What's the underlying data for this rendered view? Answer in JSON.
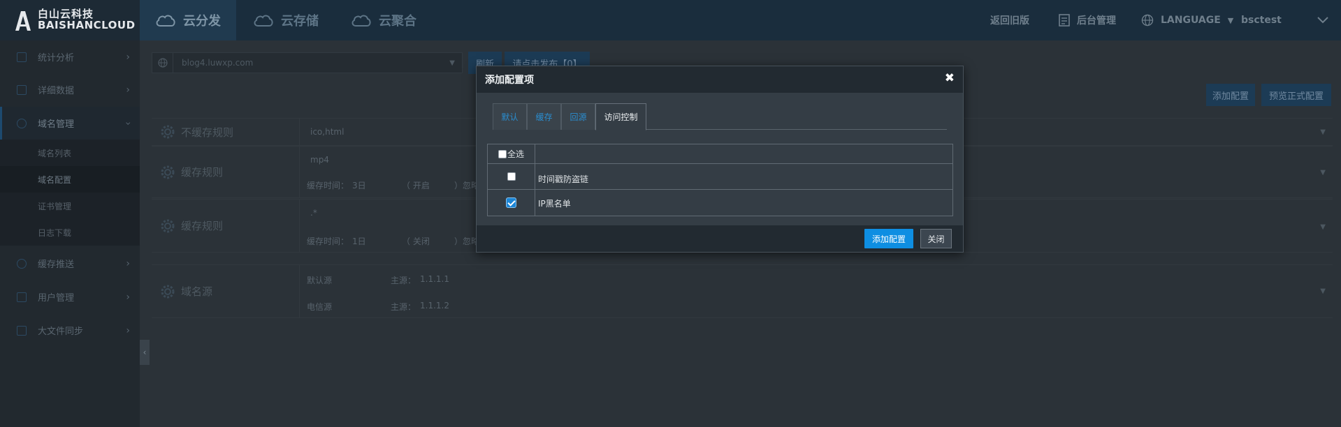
{
  "brand": {
    "name_cn": "白山云科技",
    "name_en": "BAISHANCLOUD"
  },
  "nav": {
    "tabs": [
      "云分发",
      "云存储",
      "云聚合"
    ]
  },
  "header": {
    "old_version": "返回旧版",
    "admin": "后台管理",
    "language": "LANGUAGE",
    "user": "bsctest"
  },
  "sidebar": {
    "items": [
      {
        "label": "统计分析"
      },
      {
        "label": "详细数据"
      },
      {
        "label": "域名管理"
      },
      {
        "label": "缓存推送"
      },
      {
        "label": "用户管理"
      },
      {
        "label": "大文件同步"
      }
    ],
    "subitems": [
      "域名列表",
      "域名配置",
      "证书管理",
      "日志下载"
    ],
    "collapse_icon": "‹"
  },
  "main": {
    "domain_select": "blog4.luwxp.com",
    "refresh_button": "刷新",
    "publish_button": "请点击发布【0】",
    "add_config_button": "添加配置",
    "preview_button": "预览正式配置",
    "blocks": [
      {
        "label": "不缓存规则",
        "line1": "ico,html"
      },
      {
        "label": "缓存规则",
        "line1": "mp4",
        "time_label": "缓存时间：",
        "time_value": "3日",
        "flag": "（ 开启",
        "tail": "）忽略"
      },
      {
        "label": "缓存规则",
        "line1": ".*",
        "time_label": "缓存时间：",
        "time_value": "1日",
        "flag": "（ 关闭",
        "tail": "）忽略"
      },
      {
        "label": "域名源",
        "row1_name": "默认源",
        "row1_key": "主源：",
        "row1_val": "1.1.1.1",
        "row2_name": "电信源",
        "row2_key": "主源：",
        "row2_val": "1.1.1.2"
      }
    ]
  },
  "modal": {
    "title": "添加配置项",
    "close_icon": "✖",
    "tabs": [
      "默认",
      "缓存",
      "回源",
      "访问控制"
    ],
    "active_tab": "访问控制",
    "select_all": "全选",
    "rows": [
      {
        "label": "时间戳防盗链",
        "checked": false
      },
      {
        "label": "IP黑名单",
        "checked": true
      }
    ],
    "add_button": "添加配置",
    "close_button": "关闭"
  },
  "colors": {
    "accent": "#0e8ee2",
    "tab_link": "#2a8dcf"
  }
}
